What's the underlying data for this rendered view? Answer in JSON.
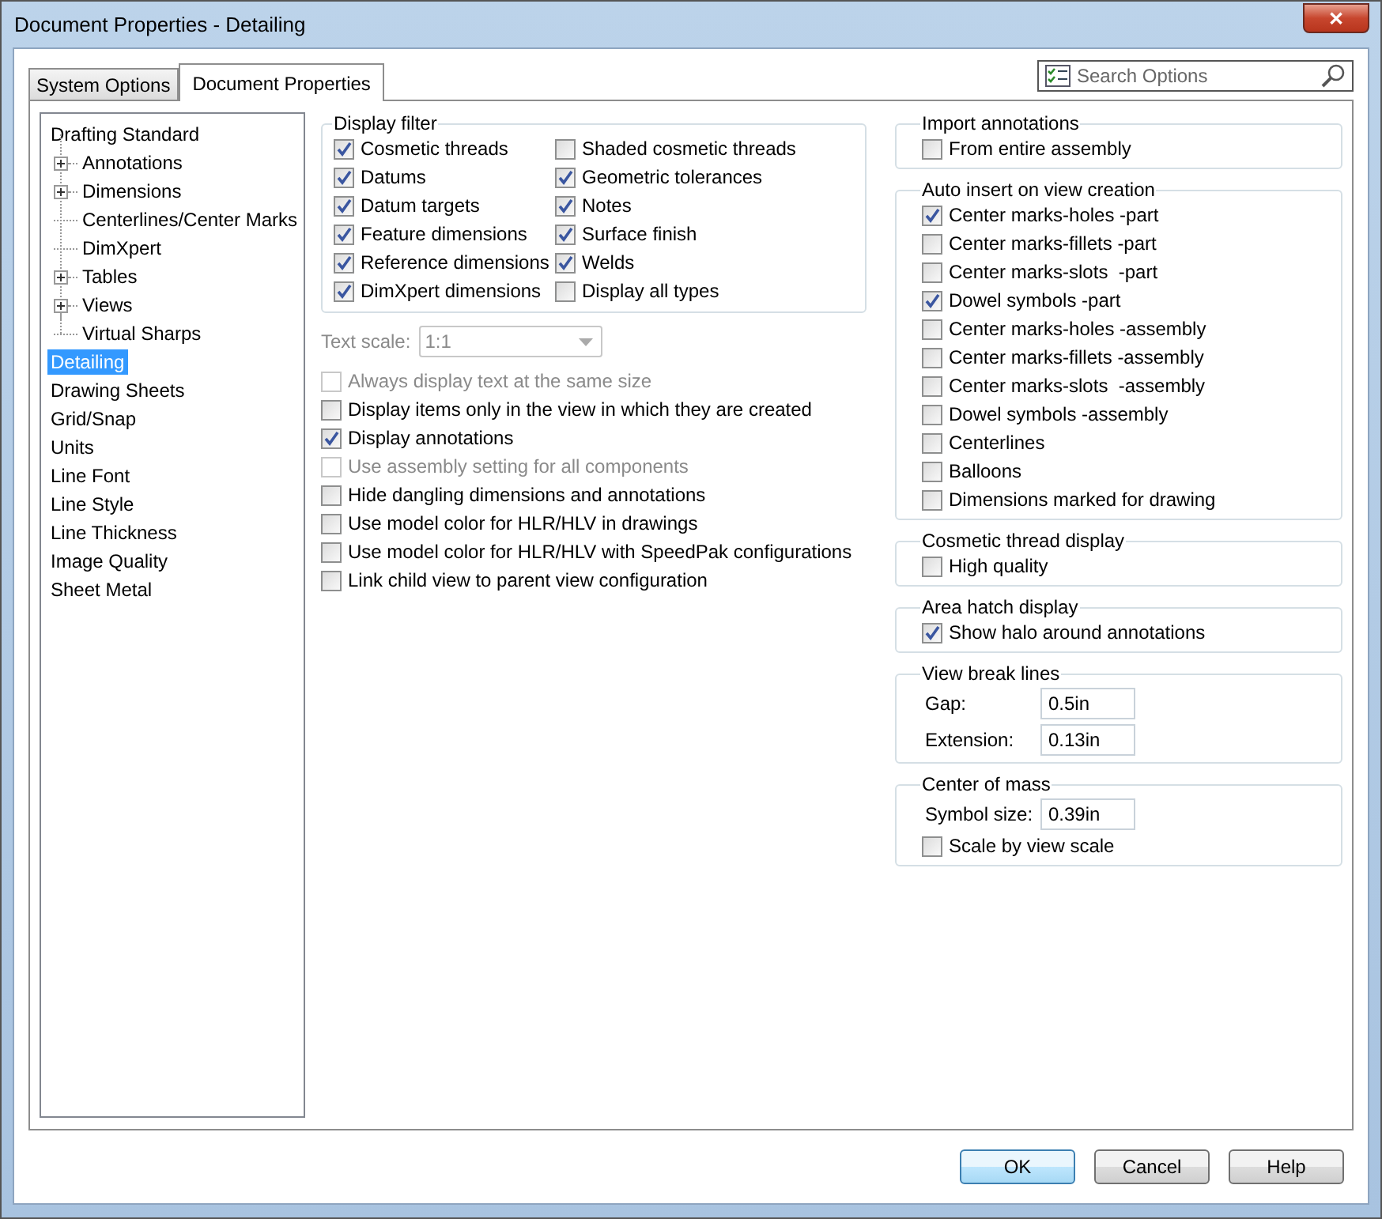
{
  "window": {
    "title": "Document Properties - Detailing",
    "close": "✕"
  },
  "tabs": [
    {
      "label": "System Options",
      "selected": false
    },
    {
      "label": "Document Properties",
      "selected": true
    }
  ],
  "search": {
    "placeholder": "Search Options"
  },
  "tree": [
    {
      "label": "Drafting Standard",
      "selected": false,
      "children": [
        {
          "label": "Annotations",
          "expanded": false
        },
        {
          "label": "Dimensions",
          "expanded": false
        },
        {
          "label": "Centerlines/Center Marks"
        },
        {
          "label": "DimXpert"
        },
        {
          "label": "Tables",
          "expanded": false
        },
        {
          "label": "Views",
          "expanded": false
        },
        {
          "label": "Virtual Sharps"
        }
      ]
    },
    {
      "label": "Detailing",
      "selected": true
    },
    {
      "label": "Drawing Sheets",
      "selected": false
    },
    {
      "label": "Grid/Snap",
      "selected": false
    },
    {
      "label": "Units",
      "selected": false
    },
    {
      "label": "Line Font",
      "selected": false
    },
    {
      "label": "Line Style",
      "selected": false
    },
    {
      "label": "Line Thickness",
      "selected": false
    },
    {
      "label": "Image Quality",
      "selected": false
    },
    {
      "label": "Sheet Metal",
      "selected": false
    }
  ],
  "display_filter": {
    "title": "Display filter",
    "items": [
      {
        "label": "Cosmetic threads",
        "checked": true
      },
      {
        "label": "Shaded cosmetic threads",
        "checked": false
      },
      {
        "label": "Datums",
        "checked": true
      },
      {
        "label": "Geometric tolerances",
        "checked": true
      },
      {
        "label": "Datum targets",
        "checked": true
      },
      {
        "label": "Notes",
        "checked": true
      },
      {
        "label": "Feature dimensions",
        "checked": true
      },
      {
        "label": "Surface finish",
        "checked": true
      },
      {
        "label": "Reference dimensions",
        "checked": true
      },
      {
        "label": "Welds",
        "checked": true
      },
      {
        "label": "DimXpert dimensions",
        "checked": true
      },
      {
        "label": "Display all types",
        "checked": false
      }
    ]
  },
  "text_scale": {
    "label": "Text scale:",
    "value": "1:1",
    "disabled": true
  },
  "options": [
    {
      "label": "Always display text at the same size",
      "checked": false,
      "disabled": true
    },
    {
      "label": "Display items only in the view in which they are created",
      "checked": false,
      "disabled": false
    },
    {
      "label": "Display annotations",
      "checked": true,
      "disabled": false
    },
    {
      "label": "Use assembly setting for all components",
      "checked": false,
      "disabled": true
    },
    {
      "label": "Hide dangling dimensions and annotations",
      "checked": false,
      "disabled": false
    },
    {
      "label": "Use model color for HLR/HLV in drawings",
      "checked": false,
      "disabled": false
    },
    {
      "label": "Use model color for HLR/HLV with SpeedPak configurations",
      "checked": false,
      "disabled": false
    },
    {
      "label": "Link child view to parent view configuration",
      "checked": false,
      "disabled": false
    }
  ],
  "groups": [
    {
      "title": "Import annotations",
      "items": [
        {
          "kind": "checkbox",
          "label": "From entire assembly",
          "checked": false
        }
      ]
    },
    {
      "title": "Auto insert on view creation",
      "items": [
        {
          "kind": "checkbox",
          "label": "Center marks-holes -part",
          "checked": true
        },
        {
          "kind": "checkbox",
          "label": "Center marks-fillets -part",
          "checked": false
        },
        {
          "kind": "checkbox",
          "label": "Center marks-slots  -part",
          "checked": false
        },
        {
          "kind": "checkbox",
          "label": "Dowel symbols -part",
          "checked": true
        },
        {
          "kind": "checkbox",
          "label": "Center marks-holes -assembly",
          "checked": false
        },
        {
          "kind": "checkbox",
          "label": "Center marks-fillets -assembly",
          "checked": false
        },
        {
          "kind": "checkbox",
          "label": "Center marks-slots  -assembly",
          "checked": false
        },
        {
          "kind": "checkbox",
          "label": "Dowel symbols -assembly",
          "checked": false
        },
        {
          "kind": "checkbox",
          "label": "Centerlines",
          "checked": false
        },
        {
          "kind": "checkbox",
          "label": "Balloons",
          "checked": false
        },
        {
          "kind": "checkbox",
          "label": "Dimensions marked for drawing",
          "checked": false
        }
      ]
    },
    {
      "title": "Cosmetic thread display",
      "items": [
        {
          "kind": "checkbox",
          "label": "High quality",
          "checked": false
        }
      ]
    },
    {
      "title": "Area hatch display",
      "items": [
        {
          "kind": "checkbox",
          "label": "Show halo around annotations",
          "checked": true
        }
      ]
    },
    {
      "title": "View break lines",
      "items": [
        {
          "kind": "field",
          "label": "Gap:",
          "value": "0.5in"
        },
        {
          "kind": "field",
          "label": "Extension:",
          "value": "0.13in"
        }
      ]
    },
    {
      "title": "Center of mass",
      "items": [
        {
          "kind": "field",
          "label": "Symbol size:",
          "value": "0.39in"
        },
        {
          "kind": "checkbox",
          "label": "Scale by view scale",
          "checked": false
        }
      ]
    }
  ],
  "buttons": [
    {
      "label": "OK",
      "default": true
    },
    {
      "label": "Cancel",
      "default": false
    },
    {
      "label": "Help",
      "default": false
    }
  ]
}
